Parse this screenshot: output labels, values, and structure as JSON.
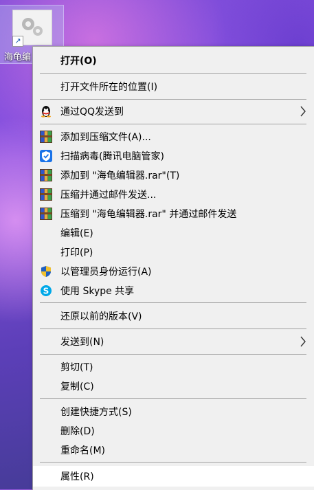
{
  "desktop": {
    "icon_label": "海龟编"
  },
  "menu": {
    "items": {
      "open": "打开(O)",
      "open_location": "打开文件所在的位置(I)",
      "send_qq": "通过QQ发送到",
      "add_archive": "添加到压缩文件(A)...",
      "scan_virus": "扫描病毒(腾讯电脑管家)",
      "add_rar": "添加到 \"海龟编辑器.rar\"(T)",
      "compress_email": "压缩并通过邮件发送...",
      "compress_rar_email": "压缩到 \"海龟编辑器.rar\" 并通过邮件发送",
      "edit": "编辑(E)",
      "print": "打印(P)",
      "run_as_admin": "以管理员身份运行(A)",
      "share_skype": "使用 Skype 共享",
      "restore_versions": "还原以前的版本(V)",
      "send_to": "发送到(N)",
      "cut": "剪切(T)",
      "copy": "复制(C)",
      "create_shortcut": "创建快捷方式(S)",
      "delete": "删除(D)",
      "rename": "重命名(M)",
      "properties": "属性(R)"
    }
  }
}
